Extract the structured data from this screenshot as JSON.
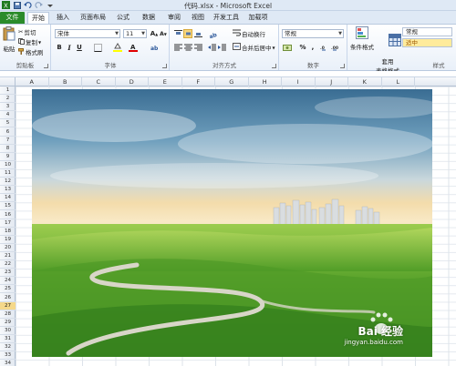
{
  "window": {
    "title": "代码.xlsx - Microsoft Excel"
  },
  "tabs": [
    {
      "label": "文件"
    },
    {
      "label": "开始"
    },
    {
      "label": "插入"
    },
    {
      "label": "页面布局"
    },
    {
      "label": "公式"
    },
    {
      "label": "数据"
    },
    {
      "label": "审阅"
    },
    {
      "label": "视图"
    },
    {
      "label": "开发工具"
    },
    {
      "label": "加载项"
    }
  ],
  "ribbon": {
    "clipboard": {
      "paste": "粘贴",
      "cut": "剪切",
      "copy": "复制",
      "format_painter": "格式刷",
      "label": "剪贴板"
    },
    "font": {
      "name": "宋体",
      "size": "11",
      "label": "字体"
    },
    "alignment": {
      "wrap": "自动换行",
      "merge": "合并后居中",
      "label": "对齐方式"
    },
    "number": {
      "format": "常规",
      "percent": "%",
      "comma": ",",
      "label": "数字"
    },
    "styles": {
      "conditional": "条件格式",
      "table": "套用\n表格格式",
      "normal": "常规",
      "neutral": "适中",
      "label": "样式"
    }
  },
  "columns": [
    "A",
    "B",
    "C",
    "D",
    "E",
    "F",
    "G",
    "H",
    "I",
    "J",
    "K",
    "L"
  ],
  "rows": [
    "1",
    "2",
    "3",
    "4",
    "5",
    "6",
    "7",
    "8",
    "9",
    "10",
    "11",
    "12",
    "13",
    "14",
    "15",
    "16",
    "17",
    "18",
    "19",
    "20",
    "21",
    "22",
    "23",
    "24",
    "25",
    "26",
    "27",
    "28",
    "29",
    "30",
    "31",
    "32",
    "33",
    "34"
  ],
  "selected_row": "27",
  "picture": {
    "watermark_brand": "Bai 经验",
    "watermark_url": "jingyan.baidu.com"
  },
  "colors": {
    "file_tab": "#2a8b2a",
    "accent": "#2b579a",
    "selected_header": "#f5d88a"
  }
}
